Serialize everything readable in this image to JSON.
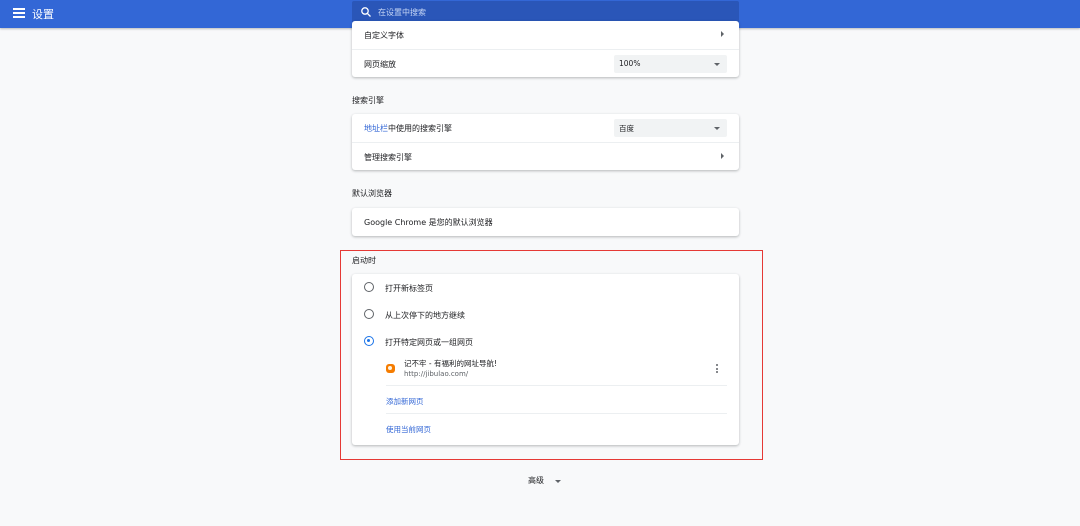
{
  "header": {
    "title": "设置",
    "search_placeholder": "在设置中搜索"
  },
  "appearance": {
    "custom_fonts": "自定义字体",
    "page_zoom_label": "网页缩放",
    "page_zoom_value": "100%"
  },
  "search_engine": {
    "section_title": "搜索引擎",
    "address_bar_link": "地址栏",
    "address_bar_rest": "中使用的搜索引擎",
    "engine_value": "百度",
    "manage_label": "管理搜索引擎"
  },
  "default_browser": {
    "section_title": "默认浏览器",
    "status": "Google Chrome 是您的默认浏览器"
  },
  "on_startup": {
    "section_title": "启动时",
    "options": [
      {
        "label": "打开新标签页",
        "checked": false
      },
      {
        "label": "从上次停下的地方继续",
        "checked": false
      },
      {
        "label": "打开特定网页或一组网页",
        "checked": true
      }
    ],
    "pages": [
      {
        "title": "记不牢 - 有福利的网址导航!",
        "url": "http://jibulao.com/"
      }
    ],
    "add_new_page": "添加新网页",
    "use_current_pages": "使用当前网页"
  },
  "advanced": {
    "label": "高级"
  },
  "colors": {
    "header_bg": "#3367d6",
    "link": "#3367d6",
    "highlight_border": "#e53935",
    "radio_checked": "#1a73e8"
  }
}
